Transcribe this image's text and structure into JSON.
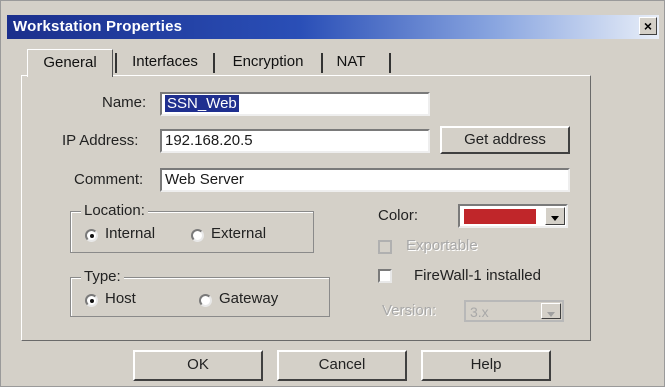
{
  "window": {
    "title": "Workstation Properties",
    "close_glyph": "×"
  },
  "tabs": [
    {
      "label": "General",
      "active": true
    },
    {
      "label": "Interfaces",
      "active": false
    },
    {
      "label": "Encryption",
      "active": false
    },
    {
      "label": "NAT",
      "active": false
    }
  ],
  "form": {
    "name_label": "Name:",
    "name_value": "SSN_Web",
    "ip_label": "IP Address:",
    "ip_value": "192.168.20.5",
    "get_address_label": "Get address",
    "comment_label": "Comment:",
    "comment_value": "Web Server"
  },
  "location": {
    "title": "Location:",
    "options": [
      {
        "label": "Internal",
        "checked": true
      },
      {
        "label": "External",
        "checked": false
      }
    ]
  },
  "type": {
    "title": "Type:",
    "options": [
      {
        "label": "Host",
        "checked": true
      },
      {
        "label": "Gateway",
        "checked": false
      }
    ]
  },
  "color": {
    "label": "Color:",
    "value_color": "#c0262a"
  },
  "exportable": {
    "label": "Exportable",
    "checked": false,
    "enabled": false
  },
  "firewall": {
    "label": "FireWall-1 installed",
    "checked": false,
    "enabled": true
  },
  "version": {
    "label": "Version:",
    "value": "3.x",
    "enabled": false
  },
  "buttons": {
    "ok": "OK",
    "cancel": "Cancel",
    "help": "Help"
  }
}
